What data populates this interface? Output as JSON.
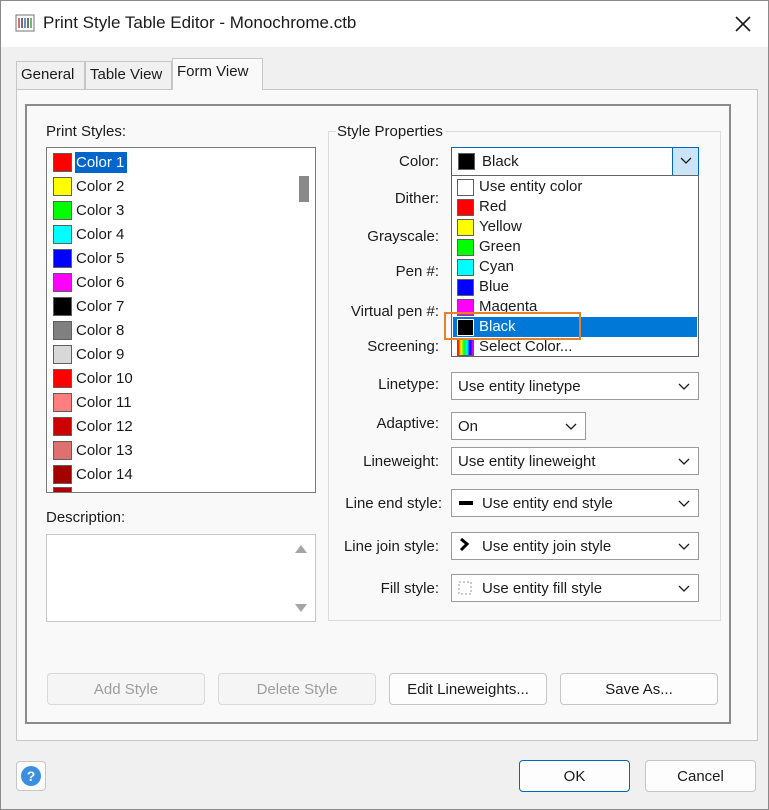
{
  "window": {
    "title": "Print Style Table Editor - Monochrome.ctb"
  },
  "tabs": [
    {
      "label": "General",
      "active": false
    },
    {
      "label": "Table View",
      "active": false
    },
    {
      "label": "Form View",
      "active": true
    }
  ],
  "print_styles": {
    "label": "Print Styles:",
    "selected_index": 0,
    "items": [
      {
        "label": "Color 1",
        "color": "#ff0000"
      },
      {
        "label": "Color 2",
        "color": "#ffff00"
      },
      {
        "label": "Color 3",
        "color": "#00ff00"
      },
      {
        "label": "Color 4",
        "color": "#00ffff"
      },
      {
        "label": "Color 5",
        "color": "#0000ff"
      },
      {
        "label": "Color 6",
        "color": "#ff00ff"
      },
      {
        "label": "Color 7",
        "color": "#000000"
      },
      {
        "label": "Color 8",
        "color": "#808080"
      },
      {
        "label": "Color 9",
        "color": "#d8d8d8"
      },
      {
        "label": "Color 10",
        "color": "#ff0000"
      },
      {
        "label": "Color 11",
        "color": "#ff7f7f"
      },
      {
        "label": "Color 12",
        "color": "#cc0000"
      },
      {
        "label": "Color 13",
        "color": "#e07070"
      },
      {
        "label": "Color 14",
        "color": "#a30000"
      }
    ]
  },
  "description": {
    "label": "Description:",
    "value": ""
  },
  "style_properties": {
    "title": "Style Properties",
    "labels": {
      "color": "Color:",
      "dither": "Dither:",
      "grayscale": "Grayscale:",
      "pen": "Pen #:",
      "virtual_pen": "Virtual pen #:",
      "screening": "Screening:",
      "linetype": "Linetype:",
      "adaptive": "Adaptive:",
      "lineweight": "Lineweight:",
      "line_end_style": "Line end style:",
      "line_join_style": "Line join style:",
      "fill_style": "Fill style:"
    },
    "color_value": "Black",
    "linetype_value": "Use entity linetype",
    "adaptive_value": "On",
    "lineweight_value": "Use entity lineweight",
    "line_end_value": "Use entity end style",
    "line_join_value": "Use entity join style",
    "fill_value": "Use entity fill style"
  },
  "color_dropdown": {
    "selected_index": 7,
    "items": [
      {
        "label": "Use entity color",
        "color": "#ffffff"
      },
      {
        "label": "Red",
        "color": "#ff0000"
      },
      {
        "label": "Yellow",
        "color": "#ffff00"
      },
      {
        "label": "Green",
        "color": "#00ff00"
      },
      {
        "label": "Cyan",
        "color": "#00ffff"
      },
      {
        "label": "Blue",
        "color": "#0000ff"
      },
      {
        "label": "Magenta",
        "color": "#ff00ff"
      },
      {
        "label": "Black",
        "color": "#000000"
      },
      {
        "label": "Select Color...",
        "color": "multicolor",
        "icon": "color-picker-icon"
      }
    ]
  },
  "buttons": {
    "add_style": "Add Style",
    "delete_style": "Delete Style",
    "edit_lineweights": "Edit Lineweights...",
    "save_as": "Save As...",
    "ok": "OK",
    "cancel": "Cancel",
    "help": "?"
  },
  "colors": {
    "selection": "#0078d7",
    "focus_border": "#0067c0",
    "annotation_highlight": "#e8812a"
  }
}
